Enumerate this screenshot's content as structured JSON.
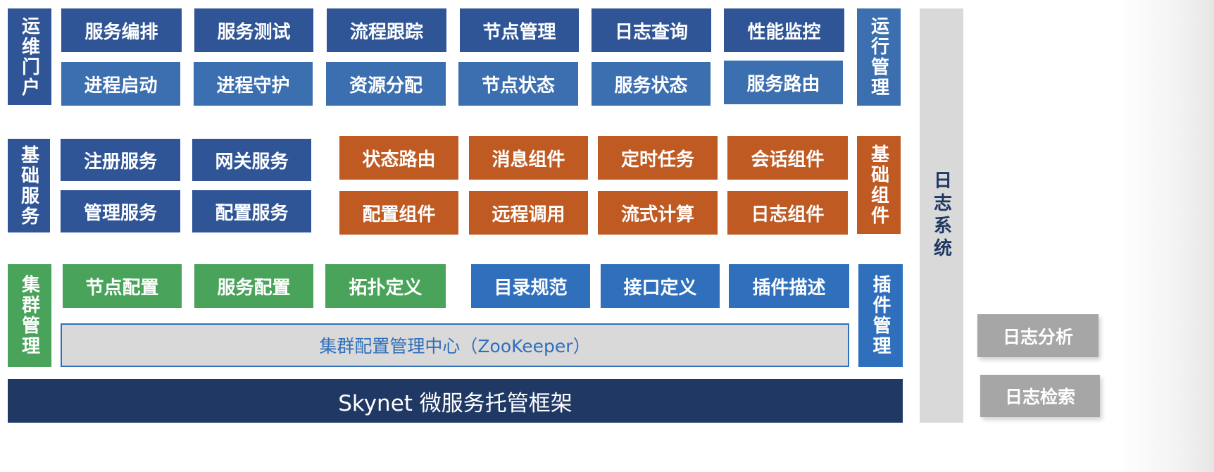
{
  "ops": {
    "left_label": "运维门户",
    "right_label": "运行管理",
    "row1": [
      "服务编排",
      "服务测试",
      "流程跟踪",
      "节点管理",
      "日志查询",
      "性能监控"
    ],
    "row2": [
      "进程启动",
      "进程守护",
      "资源分配",
      "节点状态",
      "服务状态",
      "服务路由"
    ]
  },
  "base": {
    "left_label": "基础服务",
    "right_label": "基础组件",
    "services_row1": [
      "注册服务",
      "网关服务"
    ],
    "services_row2": [
      "管理服务",
      "配置服务"
    ],
    "components_row1": [
      "状态路由",
      "消息组件",
      "定时任务",
      "会话组件"
    ],
    "components_row2": [
      "配置组件",
      "远程调用",
      "流式计算",
      "日志组件"
    ]
  },
  "cluster": {
    "left_label": "集群管理",
    "right_label": "插件管理",
    "cluster_items": [
      "节点配置",
      "服务配置",
      "拓扑定义"
    ],
    "plugin_items": [
      "目录规范",
      "接口定义",
      "插件描述"
    ],
    "center": "集群配置管理中心（ZooKeeper）"
  },
  "framework": {
    "label": "Skynet 微服务托管框架"
  },
  "log": {
    "system_label": "日志系统",
    "analysis": "日志分析",
    "search": "日志检索"
  },
  "colors": {
    "navy": "#2f5597",
    "mid_blue": "#3c6fb0",
    "orange": "#bf5a22",
    "green": "#4aa35a",
    "blue": "#2f6fbc",
    "dark_navy": "#203864",
    "gray": "#d9d9d9"
  }
}
